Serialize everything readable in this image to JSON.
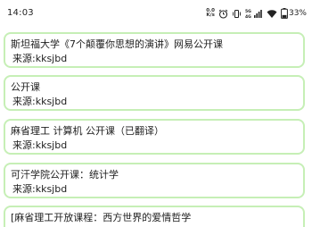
{
  "status_bar": {
    "time": "14:03",
    "speed_value": "0.0",
    "speed_unit": "K/s",
    "network_label": "5G",
    "network_label_2": "4G",
    "battery_percent": "33%",
    "icons": [
      "speed-indicator",
      "alarm-icon",
      "vibrate-icon",
      "wifi-icon",
      "signal-icon",
      "battery-icon"
    ],
    "battery_level": 0.33
  },
  "list": {
    "items": [
      {
        "title": "斯坦福大学《7个颠覆你思想的演讲》网易公开课",
        "source": "来源:kksjbd"
      },
      {
        "title": "公开课",
        "source": "来源:kksjbd"
      },
      {
        "title": "麻省理工  计算机 公开课（已翻译）",
        "source": "来源:kksjbd"
      },
      {
        "title": "可汗学院公开课：统计学",
        "source": "来源:kksjbd"
      },
      {
        "title": "[麻省理工开放课程：西方世界的爱情哲学"
      }
    ]
  },
  "colors": {
    "card_border": "#c6efb6",
    "background": "#ffffff",
    "text": "#1e1e1e"
  }
}
